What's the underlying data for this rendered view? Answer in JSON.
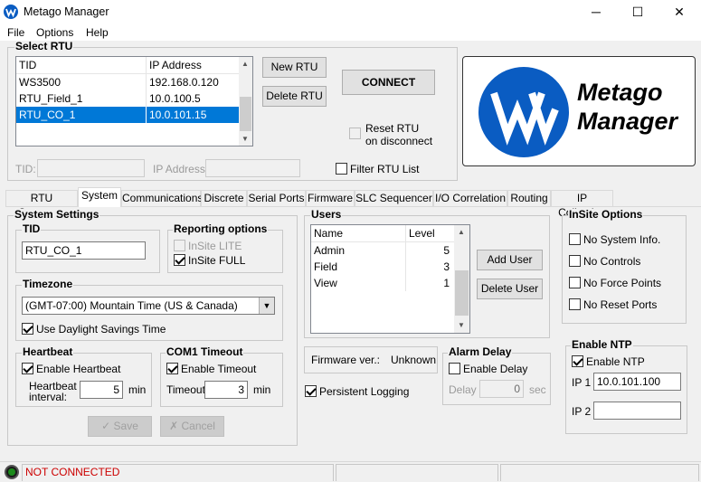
{
  "window": {
    "title": "Metago Manager",
    "minimize_glyph": "─",
    "maximize_glyph": "☐",
    "close_glyph": "✕"
  },
  "menu": [
    "File",
    "Options",
    "Help"
  ],
  "select_rtu": {
    "title": "Select RTU",
    "columns": [
      "TID",
      "IP Address"
    ],
    "rows": [
      {
        "tid": "WS3500",
        "ip": "192.168.0.120"
      },
      {
        "tid": "RTU_Field_1",
        "ip": "10.0.100.5"
      },
      {
        "tid": "RTU_CO_1",
        "ip": "10.0.101.15"
      }
    ],
    "selected_index": 2,
    "new_rtu": "New RTU",
    "delete_rtu": "Delete RTU",
    "connect": "CONNECT",
    "reset_rtu": "Reset RTU",
    "reset_rtu_2": "on disconnect",
    "tid_label": "TID:",
    "ip_label": "IP Address:",
    "filter_label": "Filter RTU List"
  },
  "logo": {
    "line1": "Metago",
    "line2": "Manager",
    "brand_color": "#0a5cc2"
  },
  "tabs": [
    "RTU Summary",
    "System",
    "Communications",
    "Discrete",
    "Serial Ports",
    "Firmware",
    "SLC Sequencer",
    "I/O Correlation",
    "Routing",
    "IP Collection"
  ],
  "active_tab": "System",
  "system_settings": {
    "title": "System Settings",
    "tid_title": "TID",
    "tid_value": "RTU_CO_1",
    "reporting_title": "Reporting options",
    "insite_lite": "InSite LITE",
    "insite_full": "InSite FULL",
    "timezone_title": "Timezone",
    "timezone_value": "(GMT-07:00) Mountain Time (US & Canada)",
    "dst_label": "Use Daylight Savings Time",
    "heartbeat_title": "Heartbeat",
    "enable_heartbeat": "Enable Heartbeat",
    "heartbeat_interval_1": "Heartbeat",
    "heartbeat_interval_2": "interval:",
    "heartbeat_value": "5",
    "min_label": "min",
    "com1_title": "COM1 Timeout",
    "enable_timeout": "Enable Timeout",
    "timeout_label": "Timeout",
    "timeout_value": "3",
    "save": "Save",
    "cancel": "Cancel"
  },
  "users": {
    "title": "Users",
    "columns": [
      "Name",
      "Level"
    ],
    "rows": [
      {
        "name": "Admin",
        "level": "5"
      },
      {
        "name": "Field",
        "level": "3"
      },
      {
        "name": "View",
        "level": "1"
      }
    ],
    "add_user": "Add User",
    "delete_user": "Delete User"
  },
  "firmware": {
    "label": "Firmware ver.:",
    "value": "Unknown"
  },
  "persistent_logging": "Persistent Logging",
  "alarm_delay": {
    "title": "Alarm Delay",
    "enable": "Enable Delay",
    "delay_label": "Delay",
    "value": "0",
    "unit": "sec"
  },
  "insite_options": {
    "title": "InSite Options",
    "items": [
      "No System Info.",
      "No Controls",
      "No Force Points",
      "No Reset Ports"
    ]
  },
  "ntp": {
    "title": "Enable NTP",
    "enable": "Enable NTP",
    "ip1_label": "IP 1",
    "ip1_value": "10.0.101.100",
    "ip2_label": "IP 2",
    "ip2_value": ""
  },
  "status": {
    "text": "NOT CONNECTED",
    "color": "#cc0000",
    "indicator_color": "#1a8a1a"
  }
}
